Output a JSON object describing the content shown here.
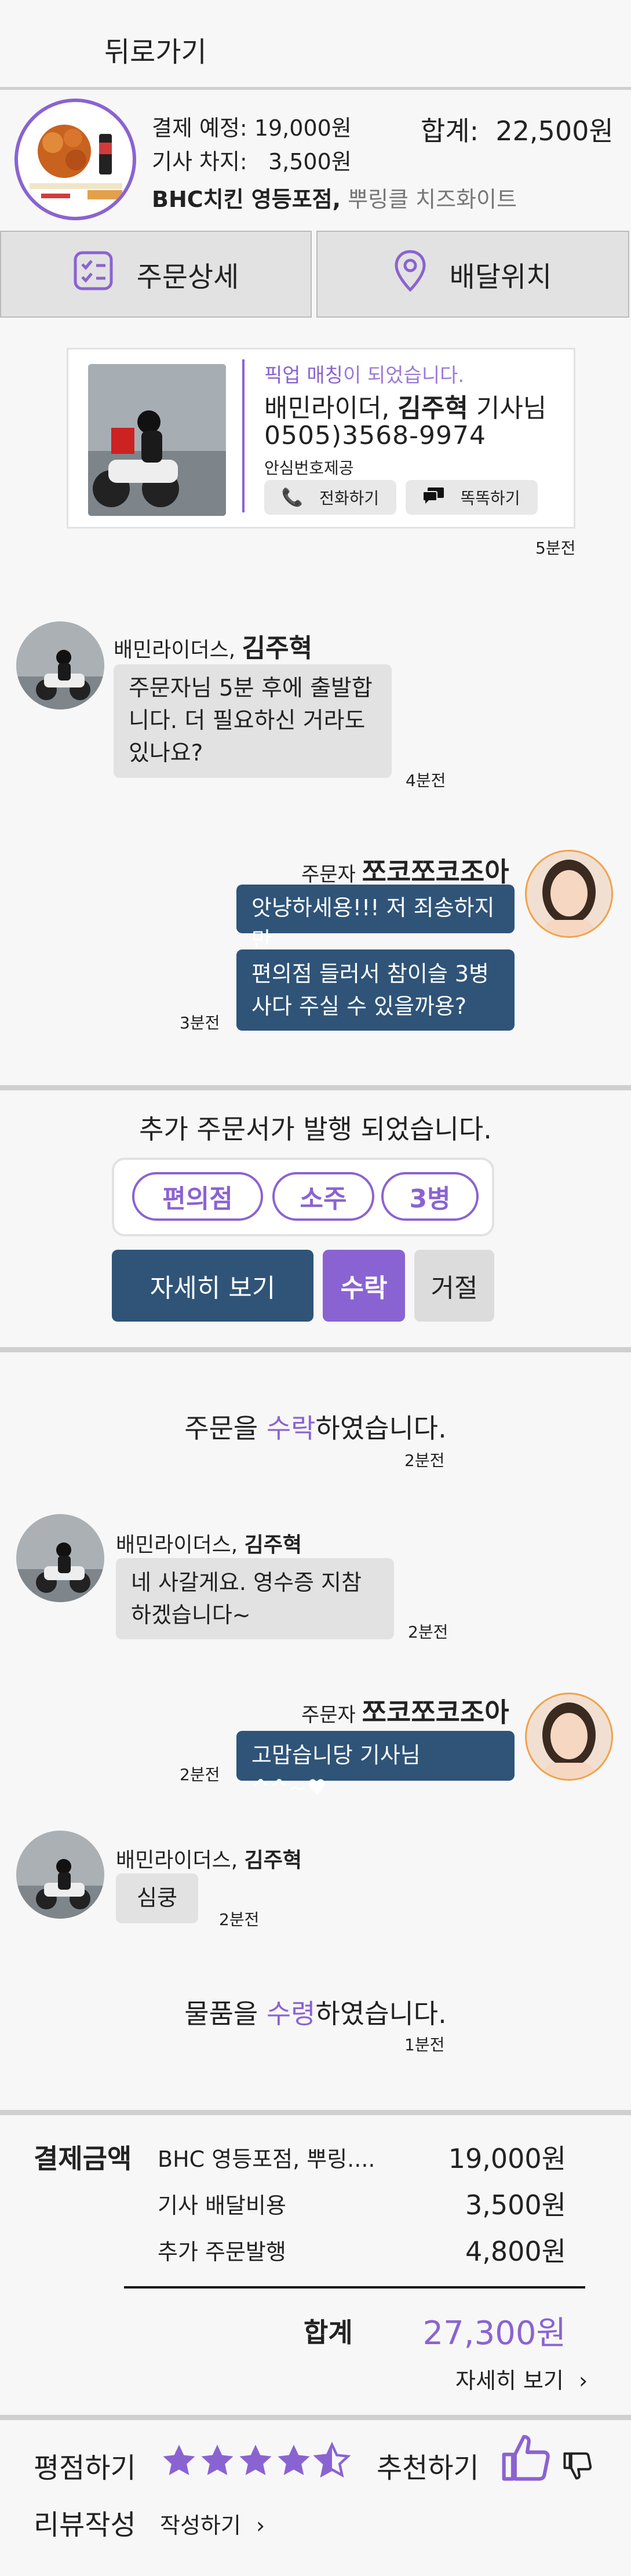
{
  "header": {
    "back_label": "뒤로가기"
  },
  "order_summary": {
    "thumbnail_text": "뿌링클 치즈화이트",
    "payment_label": "결제 예정:",
    "payment_value": "19,000원",
    "rider_label": "기사 차지:",
    "rider_value": "3,500원",
    "total_label": "합계:",
    "total_value": "22,500원",
    "store": "BHC치킨 영등포점,",
    "menu": "뿌링클 치즈화이트"
  },
  "tabs": {
    "order_detail": "주문상세",
    "delivery_location": "배달위치"
  },
  "rider_card": {
    "matched_prefix": "픽업 매칭",
    "matched_suffix": "이 되었습니다.",
    "rider_company": "배민라이더,",
    "rider_name": "김주혁",
    "rider_title": "기사님",
    "phone": "0505)3568-9974",
    "safe_number": "안심번호제공",
    "call_label": "전화하기",
    "message_label": "똑똑하기",
    "time": "5분전"
  },
  "chat": {
    "m1": {
      "sender_prefix": "배민라이더스,",
      "sender_name": "김주혁",
      "text": "주문자님 5분 후에 출발합니다. 더 필요하신 거라도 있나요?",
      "time": "4분전"
    },
    "m2": {
      "sender_prefix": "주문자",
      "sender_name": "쪼코쪼코조아",
      "text1": "앗냥하세용!!! 저 죄송하지만",
      "text2": "편의점 들러서 참이슬 3병 사다 주실 수 있을까용?",
      "time": "3분전"
    },
    "extra_order": {
      "title": "추가 주문서가 발행 되었습니다.",
      "tags": [
        "편의점",
        "소주",
        "3병"
      ],
      "detail_button": "자세히 보기",
      "accept_button": "수락",
      "reject_button": "거절"
    },
    "accepted_prefix": "주문을 ",
    "accepted_highlight": "수락",
    "accepted_suffix": "하였습니다.",
    "accepted_time": "2분전",
    "m3": {
      "sender_prefix": "배민라이더스,",
      "sender_name": "김주혁",
      "text": "네 사갈게요. 영수증 지참하겠습니다~",
      "time": "2분전"
    },
    "m4": {
      "sender_prefix": "주문자",
      "sender_name": "쪼코쪼코조아",
      "text": "고맙습니당 기사님 ^^~♥",
      "time": "2분전"
    },
    "m5": {
      "sender_prefix": "배민라이더스,",
      "sender_name": "김주혁",
      "text": "심쿵",
      "time": "2분전"
    },
    "received_prefix": "물품을 ",
    "received_highlight": "수령",
    "received_suffix": "하였습니다.",
    "received_time": "1분전"
  },
  "payment": {
    "label": "결제금액",
    "rows": [
      {
        "label": "BHC 영등포점, 뿌링....",
        "value": "19,000원"
      },
      {
        "label": "기사 배달비용",
        "value": "3,500원"
      },
      {
        "label": "추가 주문발행",
        "value": "4,800원"
      }
    ],
    "total_label": "합계",
    "total_value": "27,300원",
    "detail_link": "자세히 보기"
  },
  "review": {
    "rate_label": "평점하기",
    "rating": 4.5,
    "recommend_label": "추천하기",
    "review_label": "리뷰작성",
    "write_link": "작성하기"
  },
  "colors": {
    "accent": "#8a63d2",
    "bubble_blue": "#2f5478",
    "bubble_grey": "#e2e2e2"
  }
}
